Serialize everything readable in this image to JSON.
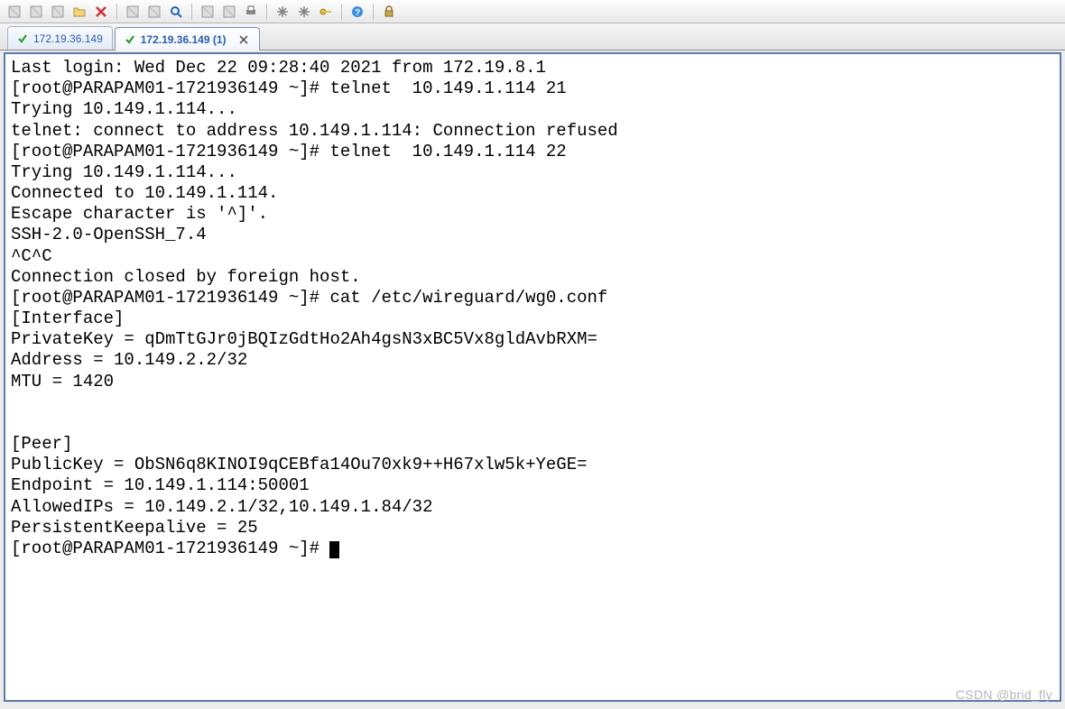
{
  "toolbar": {
    "icons": [
      "session-icon",
      "link-icon",
      "clipboard-icon",
      "folder-icon",
      "delete-icon",
      "_sep",
      "copy-icon",
      "paste-icon",
      "search-icon",
      "_sep",
      "upload-icon",
      "download-icon",
      "print-icon",
      "_sep",
      "settings-icon",
      "tools-icon",
      "key-icon",
      "_sep",
      "help-icon",
      "_sep",
      "lock-icon"
    ]
  },
  "tabs": {
    "items": [
      {
        "label": "172.19.36.149",
        "active": false,
        "closable": false
      },
      {
        "label": "172.19.36.149 (1)",
        "active": true,
        "closable": true
      }
    ]
  },
  "terminal": {
    "lines": [
      "Last login: Wed Dec 22 09:28:40 2021 from 172.19.8.1",
      "[root@PARAPAM01-1721936149 ~]# telnet  10.149.1.114 21",
      "Trying 10.149.1.114...",
      "telnet: connect to address 10.149.1.114: Connection refused",
      "[root@PARAPAM01-1721936149 ~]# telnet  10.149.1.114 22",
      "Trying 10.149.1.114...",
      "Connected to 10.149.1.114.",
      "Escape character is '^]'.",
      "SSH-2.0-OpenSSH_7.4",
      "^C^C",
      "Connection closed by foreign host.",
      "[root@PARAPAM01-1721936149 ~]# cat /etc/wireguard/wg0.conf",
      "[Interface]",
      "PrivateKey = qDmTtGJr0jBQIzGdtHo2Ah4gsN3xBC5Vx8gldAvbRXM=",
      "Address = 10.149.2.2/32",
      "MTU = 1420",
      "",
      "",
      "[Peer]",
      "PublicKey = ObSN6q8KINOI9qCEBfa14Ou70xk9++H67xlw5k+YeGE=",
      "Endpoint = 10.149.1.114:50001",
      "AllowedIPs = 10.149.2.1/32,10.149.1.84/32",
      "PersistentKeepalive = 25"
    ],
    "prompt": "[root@PARAPAM01-1721936149 ~]# "
  },
  "watermark": "CSDN @brid_fly"
}
